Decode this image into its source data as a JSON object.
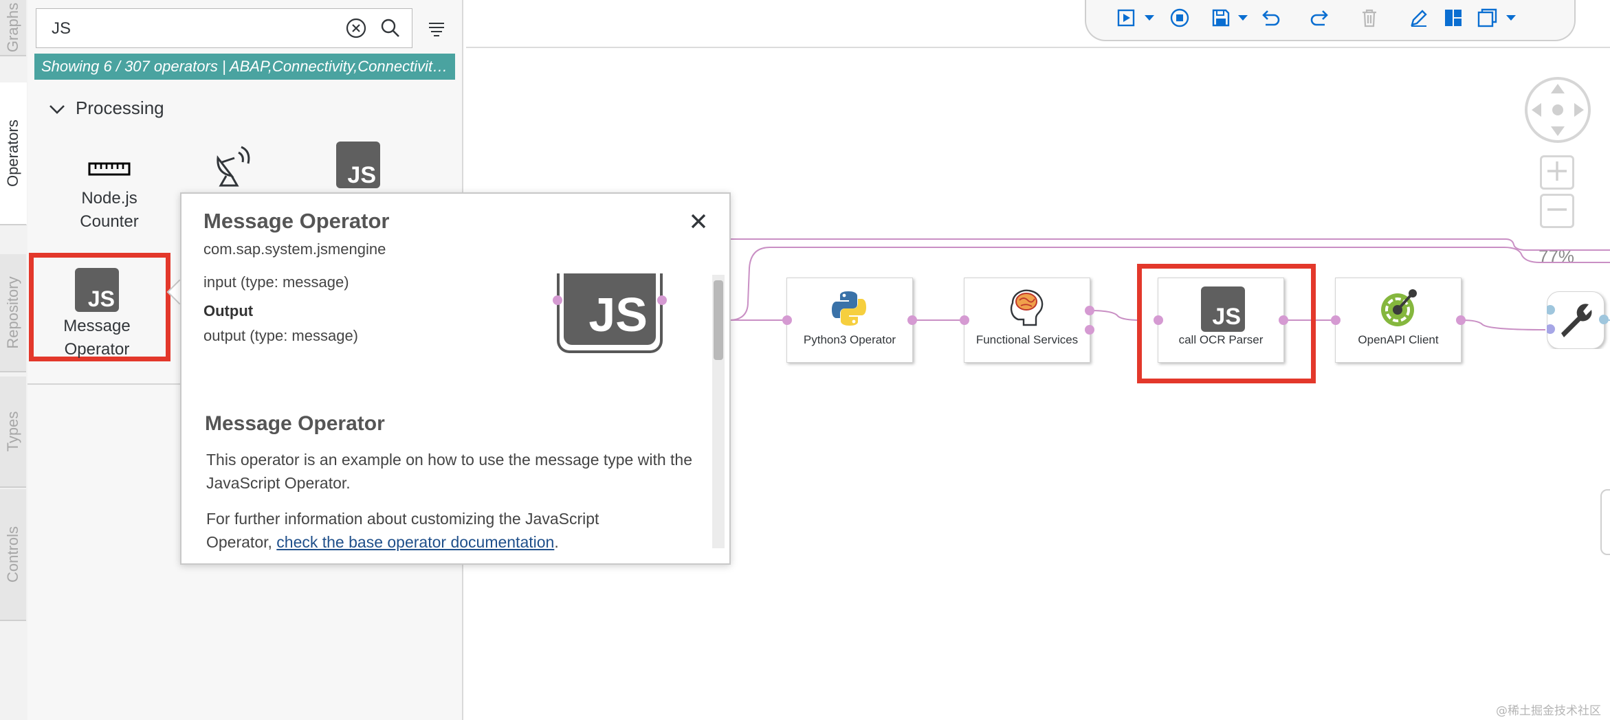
{
  "tabs": [
    "Graphs",
    "Operators",
    "Repository",
    "Types",
    "Controls"
  ],
  "search": {
    "value": "JS"
  },
  "status_text": "Showing 6 / 307 operators | ABAP,Connectivity,Connectivit…",
  "group": {
    "title": "Processing"
  },
  "operators": [
    {
      "label": "Node.js Counter",
      "icon": "ruler-icon"
    },
    {
      "label": "",
      "icon": "satellite-dish-icon"
    },
    {
      "label": "",
      "icon": "js-icon"
    },
    {
      "label": "Message Operator",
      "icon": "js-icon"
    }
  ],
  "popover": {
    "title": "Message Operator",
    "subtitle": "com.sap.system.jsmengine",
    "input_text": "input (type: message)",
    "output_heading": "Output",
    "output_text": "output (type: message)",
    "doc_title": "Message Operator",
    "doc_para1": "This operator is an example on how to use the message type with the JavaScript Operator.",
    "doc_para2_prefix": "For further information about customizing the JavaScript Operator, ",
    "doc_link": "check the base operator documentation",
    "doc_para2_suffix": "."
  },
  "canvas": {
    "zoom": "77%",
    "nodes": [
      {
        "label": "Python3 Operator",
        "icon": "python-icon"
      },
      {
        "label": "Functional Services",
        "icon": "brain-icon"
      },
      {
        "label": "call OCR Parser",
        "icon": "js-icon"
      },
      {
        "label": "OpenAPI Client",
        "icon": "openapi-icon"
      },
      {
        "label": "",
        "icon": "wrench-icon"
      }
    ]
  },
  "toolbar_icons": [
    "run-icon",
    "dropdown-icon",
    "stop-icon",
    "save-icon",
    "dropdown-icon",
    "undo-icon",
    "redo-icon",
    "delete-icon",
    "edit-icon",
    "layout-icon",
    "copy-icon",
    "dropdown-icon"
  ],
  "watermark": "@稀土掘金技术社区",
  "colors": {
    "accent": "#0a6ed1",
    "status_bar": "#4aa3a0",
    "highlight": "#e3382b",
    "port": "#d59ad2",
    "js_icon": "#5f5f5f"
  }
}
